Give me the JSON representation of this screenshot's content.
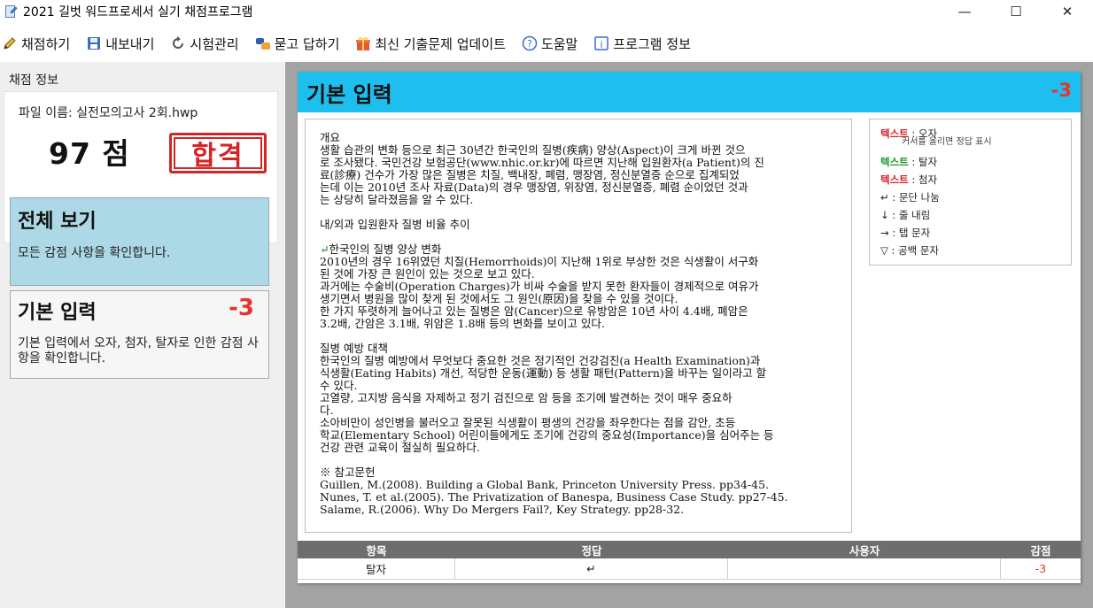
{
  "window": {
    "title": "2021 길벗 워드프로세서 실기 채점프로그램",
    "controls": [
      "—",
      "☐",
      "✕"
    ]
  },
  "toolbar": {
    "items": [
      {
        "label": "채점하기",
        "icon": "pencil-icon"
      },
      {
        "label": "내보내기",
        "icon": "floppy-disk-icon"
      },
      {
        "label": "시험관리",
        "icon": "refresh-icon"
      },
      {
        "label": "묻고 답하기",
        "icon": "chat-icon"
      },
      {
        "label": "최신 기출문제 업데이트",
        "icon": "gift-icon"
      },
      {
        "label": "도움말",
        "icon": "help-icon"
      },
      {
        "label": "프로그램 정보",
        "icon": "info-icon"
      }
    ]
  },
  "sidebar": {
    "header": "채점 정보",
    "file_name": "파일 이름: 실전모의고사 2회.hwp",
    "score": "97 점",
    "stamp": "합격",
    "cards": [
      {
        "title": "전체 보기",
        "desc": "모든 감점 사항을 확인합니다."
      },
      {
        "title": "기본 입력",
        "score": "-3",
        "desc": "기본 입력에서 오자, 첨자, 탈자로 인한 감점 사항을 확인합니다."
      }
    ]
  },
  "document": {
    "title": "기본 입력",
    "score": "-3",
    "lines": [
      "개요",
      "생활 습관의 변화 등으로 최근 30년간 한국인의 질병(疾病) 양상(Aspect)이 크게 바뀐 것으",
      "로 조사됐다. 국민건강 보험공단(www.nhic.or.kr)에 따르면 지난해 입원환자(a Patient)의 진",
      "료(診療) 건수가 가장 많은 질병은 치질, 백내장, 폐렴, 맹장염, 정신분열증 순으로 집계되었",
      "는데 이는 2010년 조사 자료(Data)의 경우 맹장염, 위장염, 정신분열증, 폐렴 순이었던 것과",
      "는 상당히 달라졌음을 알 수 있다.",
      "",
      "내/외과 입원환자 질병 비율 추이",
      "",
      "↵한국인의 질병 양상 변화",
      "2010년의 경우 16위였던 치질(Hemorrhoids)이 지난해 1위로 부상한 것은 식생활이 서구화",
      "된 것에 가장 큰 원인이 있는 것으로 보고 있다.",
      "과거에는 수술비(Operation Charges)가 비싸 수술을 받지 못한 환자들이 경제적으로 여유가",
      "생기면서 병원을 많이 찾게 된 것에서도 그 원인(原因)을 찾을 수 있을 것이다.",
      "한 가지 뚜렷하게 늘어나고 있는 질병은 암(Cancer)으로 유방암은 10년 사이 4.4배, 폐암은",
      "3.2배, 간암은 3.1배, 위암은 1.8배 등의 변화를 보이고 있다.",
      "",
      "질병 예방 대책",
      "한국인의 질병 예방에서 무엇보다 중요한 것은 정기적인 건강검진(a Health Examination)과",
      "식생활(Eating Habits) 개선, 적당한 운동(運動) 등 생활 패턴(Pattern)을 바꾸는 일이라고 할",
      "수 있다.",
      "고열량, 고지방 음식을 자제하고 정기 검진으로 암 등을 조기에 발견하는 것이 매우 중요하",
      "다.",
      "소아비만이 성인병을 불러오고 잘못된 식생활이 평생의 건강을 좌우한다는 점을 감안, 초등",
      "학교(Elementary School) 어린이들에게도 조기에 건강의 중요성(Importance)을 심어주는 등",
      "건강 관련 교육이 절실히 필요하다.",
      "",
      "※ 참고문헌",
      "Guillen, M.(2008). Building a Global Bank, Princeton University Press. pp34-45.",
      "Nunes, T. et al.(2005). The Privatization of Banespa, Business Case Study. pp27-45.",
      "Salame, R.(2006). Why Do Mergers Fail?, Key Strategy. pp28-32."
    ],
    "legend": {
      "typo_word": "텍스트",
      "typo_label": ": 오자",
      "typo_sub": "커서를 올리면 정답 표시",
      "missing_word": "텍스트",
      "missing_label": ": 탈자",
      "sub_word": "텍스트",
      "sub_label": ": 첨자",
      "para": "↵ : 문단 나눔",
      "linebreak": "↓ : 줄 내림",
      "tab": "→ : 탭 문자",
      "space": "▽ : 공백 문자"
    },
    "table": {
      "headers": [
        "항목",
        "정답",
        "사용자",
        "감점"
      ],
      "rows": [
        [
          "탈자",
          "↵",
          "",
          "-3"
        ]
      ]
    }
  }
}
